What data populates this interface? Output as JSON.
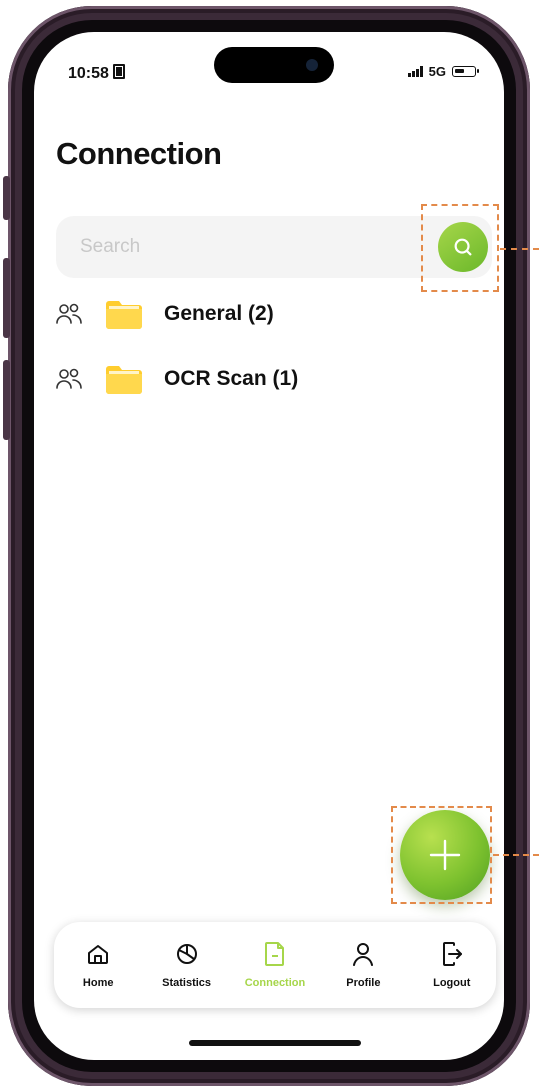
{
  "status_bar": {
    "time": "10:58",
    "network": "5G",
    "icons": [
      "sim-icon",
      "signal-icon",
      "battery-icon"
    ]
  },
  "page": {
    "title": "Connection"
  },
  "search": {
    "placeholder": "Search",
    "value": "",
    "button_icon": "search-icon"
  },
  "folders": [
    {
      "label": "General (2)",
      "icon": "folder-icon",
      "share_icon": "people-icon"
    },
    {
      "label": "OCR Scan (1)",
      "icon": "folder-icon",
      "share_icon": "people-icon"
    }
  ],
  "fab": {
    "icon": "plus-icon"
  },
  "nav": {
    "items": [
      {
        "label": "Home",
        "icon": "home-icon",
        "active": false
      },
      {
        "label": "Statistics",
        "icon": "pie-chart-icon",
        "active": false
      },
      {
        "label": "Connection",
        "icon": "document-icon",
        "active": true
      },
      {
        "label": "Profile",
        "icon": "user-icon",
        "active": false
      },
      {
        "label": "Logout",
        "icon": "logout-icon",
        "active": false
      }
    ]
  },
  "colors": {
    "accent": "#a6d64a",
    "accent_dark": "#6bb82a",
    "folder": "#ffd43b",
    "annotation": "#e38a4a",
    "frame": "#3b2a38"
  }
}
